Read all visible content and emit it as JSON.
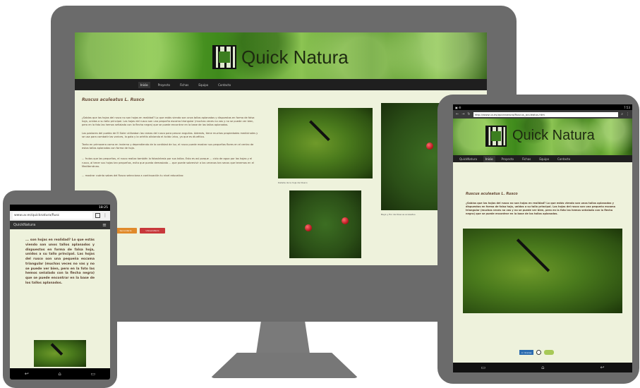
{
  "site": {
    "brand": "Quick Natura",
    "nav": [
      "Inicio",
      "Proyecto",
      "Fichas",
      "Equipo",
      "Contacto"
    ]
  },
  "desktop": {
    "article_title": "Ruscus aculeatus L. Rusco",
    "paragraphs": [
      "¿Sabías que las hojas del rusco no son hojas en realidad? Lo que estás viendo son unos tallos aplanados y dispuestos en forma de falsa hoja, unidos a su tallo principal. Las hojas del rusco son una pequeña escama triangular (muchas veces no vas y no se puede ver bien, pero en la foto las hemos señalado con la flecha negra) que se puede encontrar en la base de los tallos aplanados.",
      "Los pastores del pueblo de El Soler utilizaban las ramas del rusco para pescar anguilas. Además, tiene muchas propiedades medicinales y se usa para combatir las varices, la gota y la artritis aliviando el ácido úrico, ya que es diurético.",
      "Tanto en primavera como en invierno y dependiendo de la cantidad de luz, el rusco puede mostrar sus pequeñas flores en el centro de estos tallos aplanados con forma de hoja.",
      "... frutos que las pequeñas, el rusco realiza también la fotosíntesis por sus tallos. Esto es así porque ... ciclo de agua por las hojas y el rusco, al tener sus hojas tan pequeñas, evita que pueda demasiada ... que puede sobrevivir a los veranos tan secos que tenemos en el Mediterráneo.",
      "... mostrar cuánto sabes del Rusco selecciona a continuación tu nivel educativo:"
    ],
    "caption_leaf": "Detalle de la hoja del Rusco",
    "caption_flower": "Baya y flor del Ruscus aculeatus",
    "btn_primary": "Secundaria",
    "btn_secondary": "Universitario"
  },
  "phone": {
    "status": "18:25",
    "url": "www.uv.es/quicknatura/Rusc",
    "brand": "QuickNatura",
    "text": "... son hojas en realidad? Lo que estás viendo son unos tallos aplanados y dispuestos en forma de falsa hoja, unidos a su tallo principal. Las hojas del rusco son una pequeña escama triangular (muchas veces no vas y no se puede ver bien, pero en la foto las hemos señalado con la flecha negra) que se puede encontrar en la base de los tallos aplanados."
  },
  "tablet": {
    "status_right": "7:53",
    "url": "http://www.uv.es/quicknatura/Ruscus_aculeatus.htm",
    "nav_brand": "QuickNatura",
    "nav": [
      "Inicio",
      "Proyecto",
      "Fichas",
      "Equipo",
      "Contacto"
    ],
    "title": "Ruscus aculeatus L. Rusco",
    "text": "¿Sabías que las hojas del rusco no son hojas en realidad? Lo que estás viendo son unos tallos aplanados y dispuestos en forma de falsa hoja, unidos a su tallo principal. Las hojas del rusco son una pequeña escama triangular (muchas veces no vas y no se puede ver bien, pero en la foto las hemos señalado con la flecha negra) que se puede encontrar en la base de los tallos aplanados.",
    "badge_cc": "cc license"
  },
  "colors": {
    "device_frame": "#6b6b6b",
    "page_bg": "#eef2dc",
    "navbar": "#1f1f1f",
    "text_brown": "#5a3e2e",
    "button_red": "#c8393b",
    "button_orange": "#e08a2b"
  }
}
